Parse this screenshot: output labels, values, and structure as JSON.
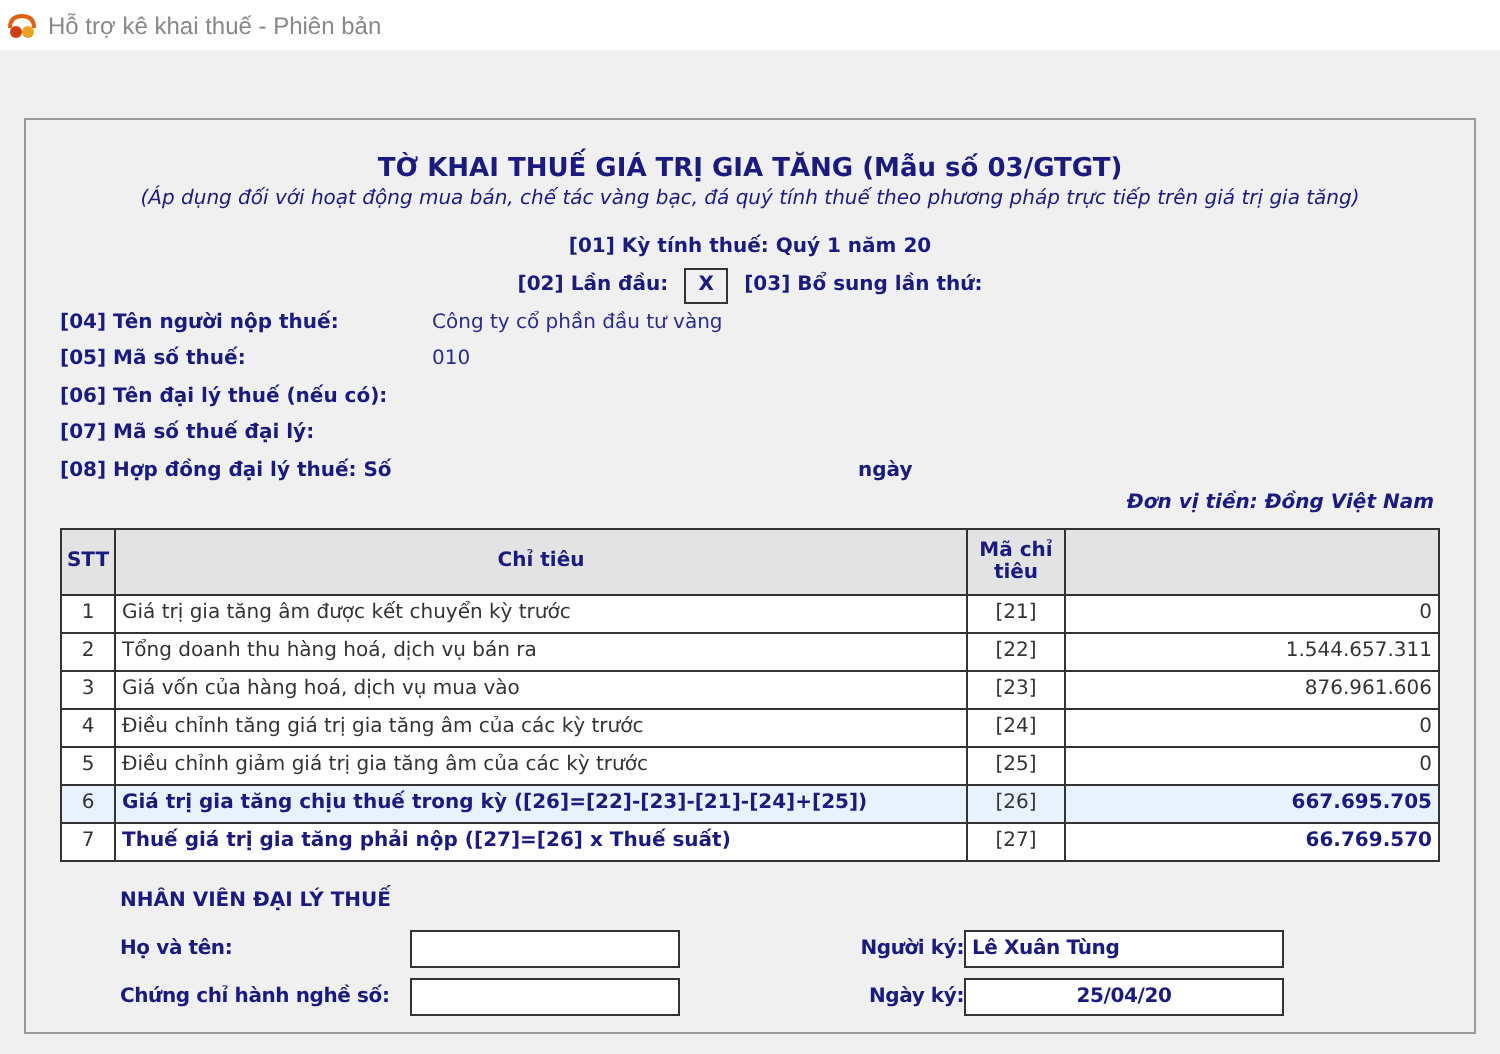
{
  "window": {
    "title": "Hỗ trợ kê khai thuế -  Phiên bản"
  },
  "form": {
    "title": "TỜ KHAI THUẾ GIÁ TRỊ GIA TĂNG (Mẫu số 03/GTGT)",
    "subtitle": "(Áp dụng đối với hoạt động mua bán, chế tác vàng bạc, đá quý tính thuế theo phương pháp trực tiếp trên giá trị gia tăng)",
    "period": "[01] Kỳ tính thuế: Quý 1 năm 20",
    "first_label": "[02]  Lần đầu:",
    "first_mark": "X",
    "first_checked": true,
    "supplement_label": "[03] Bổ sung lần thứ:",
    "fields": [
      {
        "label": "[04]  Tên người nộp thuế:",
        "value": "Công ty cổ phần đầu tư vàng"
      },
      {
        "label": "[05]  Mã số thuế:",
        "value": "010"
      },
      {
        "label": "[06]  Tên đại lý thuế (nếu có):"
      },
      {
        "label": "[07]  Mã số thuế đại lý:"
      },
      {
        "label": "[08]  Hợp đồng đại lý thuế: Số",
        "extra": "ngày"
      }
    ],
    "currency": "Đơn vị tiền: Đồng Việt Nam"
  },
  "table": {
    "columns": [
      "STT",
      "Chỉ tiêu",
      "Mã chỉ tiêu"
    ],
    "rows": [
      {
        "stt": "1",
        "item": "Giá trị gia tăng âm được kết chuyển kỳ trước",
        "code": "[21]",
        "value": "0",
        "kind": "item",
        "selected": false
      },
      {
        "stt": "2",
        "item": "Tổng doanh thu hàng hoá, dịch vụ bán ra",
        "code": "[22]",
        "value": "1.544.657.311",
        "kind": "item",
        "selected": false
      },
      {
        "stt": "3",
        "item": "Giá vốn của hàng hoá, dịch vụ mua vào",
        "code": "[23]",
        "value": "876.961.606",
        "kind": "item",
        "selected": false
      },
      {
        "stt": "4",
        "item": "Điều chỉnh tăng giá trị gia tăng âm của các kỳ trước",
        "code": "[24]",
        "value": "0",
        "kind": "item",
        "selected": false
      },
      {
        "stt": "5",
        "item": "Điều chỉnh giảm giá trị gia tăng âm của các kỳ trước",
        "code": "[25]",
        "value": "0",
        "kind": "item",
        "selected": false
      },
      {
        "stt": "6",
        "item": "Giá trị gia tăng chịu thuế trong kỳ ([26]=[22]-[23]-[21]-[24]+[25])",
        "code": "[26]",
        "value": "667.695.705",
        "kind": "total",
        "selected": true
      },
      {
        "stt": "7",
        "item": "Thuế giá trị gia tăng phải nộp ([27]=[26] x Thuế suất)",
        "code": "[27]",
        "value": "66.769.570",
        "kind": "total",
        "selected": false
      }
    ]
  },
  "agent": {
    "heading": "NHÂN VIÊN ĐẠI LÝ THUẾ",
    "name_label": "Họ và tên:",
    "cert_label": "Chứng chỉ hành nghề số:",
    "signer_label": "Người ký:",
    "signer": "Lê Xuân Tùng",
    "date_label": "Ngày ký:",
    "date": "25/04/20"
  }
}
